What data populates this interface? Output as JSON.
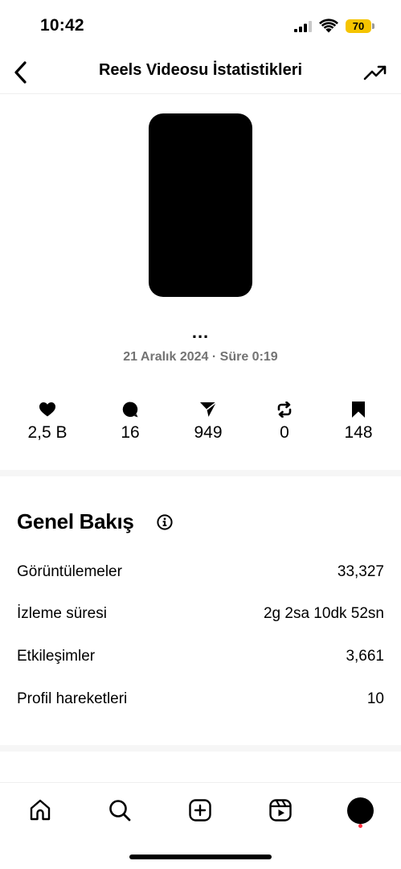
{
  "status_bar": {
    "time": "10:42",
    "battery": "70",
    "battery_color": "#f5c400"
  },
  "header": {
    "title": "Reels Videosu İstatistikleri",
    "back_icon": "chevron-left-icon",
    "trend_icon": "trending-up-icon"
  },
  "post": {
    "more": "...",
    "meta": "21 Aralık 2024 · Süre 0:19"
  },
  "stats": [
    {
      "icon": "heart-icon",
      "value": "2,5 B"
    },
    {
      "icon": "comment-icon",
      "value": "16"
    },
    {
      "icon": "share-icon",
      "value": "949"
    },
    {
      "icon": "repost-icon",
      "value": "0"
    },
    {
      "icon": "save-icon",
      "value": "148"
    }
  ],
  "overview": {
    "title": "Genel Bakış",
    "rows": [
      {
        "label": "Görüntülemeler",
        "value": "33,327"
      },
      {
        "label": "İzleme süresi",
        "value": "2g 2sa 10dk 52sn"
      },
      {
        "label": "Etkileşimler",
        "value": "3,661"
      },
      {
        "label": "Profil hareketleri",
        "value": "10"
      }
    ]
  },
  "tab_bar": [
    "home-icon",
    "search-icon",
    "create-icon",
    "reels-icon",
    "profile-avatar"
  ],
  "colors": {
    "muted_text": "#737373",
    "notification_dot": "#ff3040"
  }
}
